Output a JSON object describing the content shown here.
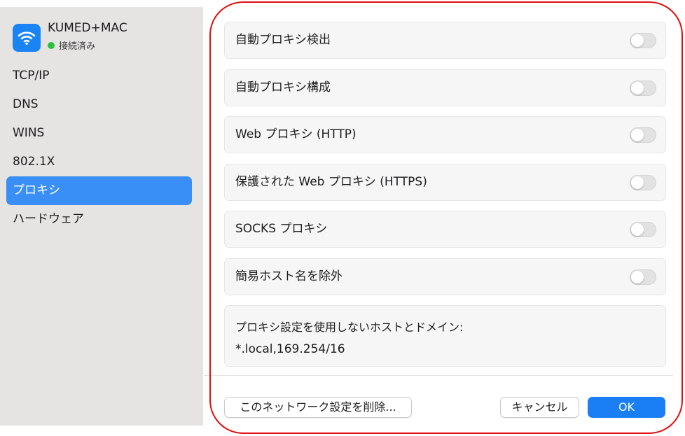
{
  "network": {
    "name": "KUMED+MAC",
    "status": "接続済み",
    "icon": "wifi-icon"
  },
  "sidebar": {
    "items": [
      {
        "label": "TCP/IP",
        "active": false
      },
      {
        "label": "DNS",
        "active": false
      },
      {
        "label": "WINS",
        "active": false
      },
      {
        "label": "802.1X",
        "active": false
      },
      {
        "label": "プロキシ",
        "active": true
      },
      {
        "label": "ハードウェア",
        "active": false
      }
    ]
  },
  "proxy": {
    "options": [
      {
        "label": "自動プロキシ検出",
        "enabled": false
      },
      {
        "label": "自動プロキシ構成",
        "enabled": false
      },
      {
        "label": "Web プロキシ (HTTP)",
        "enabled": false
      },
      {
        "label": "保護された Web プロキシ (HTTPS)",
        "enabled": false
      },
      {
        "label": "SOCKS プロキシ",
        "enabled": false
      },
      {
        "label": "簡易ホスト名を除外",
        "enabled": false
      }
    ],
    "bypass_label": "プロキシ設定を使用しないホストとドメイン:",
    "bypass_value": "*.local,169.254/16"
  },
  "footer": {
    "delete_label": "このネットワーク設定を削除...",
    "cancel_label": "キャンセル",
    "ok_label": "OK"
  },
  "colors": {
    "accent": "#1a7ff5",
    "sidebar_selected": "#3a8ff7",
    "status_connected": "#29c13f",
    "annotation_outline": "#e01010"
  }
}
